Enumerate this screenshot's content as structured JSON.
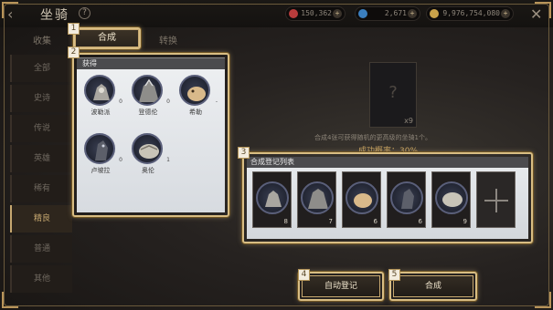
{
  "header": {
    "title": "坐骑",
    "help_symbol": "?",
    "back_symbol": "‹",
    "close_symbol": "✕"
  },
  "currencies": [
    {
      "value": "150,362",
      "color": "#b83c3c",
      "icon": "red-gem-icon"
    },
    {
      "value": "2,671",
      "color": "#3b7fbf",
      "icon": "blue-gem-icon"
    },
    {
      "value": "9,976,754,080",
      "color": "#c9a24a",
      "icon": "gold-coin-icon"
    }
  ],
  "subtabs": [
    "收集",
    "合成",
    "转换"
  ],
  "categories": [
    "全部",
    "史诗",
    "传说",
    "英雄",
    "稀有",
    "精良",
    "普通",
    "其他"
  ],
  "active_category_index": 5,
  "synth_tab": {
    "label": "合成"
  },
  "acquired": {
    "title": "获得",
    "mounts": [
      {
        "name": "波勒派",
        "level": "0",
        "icon": "mount-polepai-icon"
      },
      {
        "name": "登德伦",
        "level": "0",
        "icon": "mount-dendelun-icon"
      },
      {
        "name": "希勒",
        "level": "-",
        "icon": "mount-xile-icon"
      },
      {
        "name": "卢坡拉",
        "level": "0",
        "icon": "mount-lupola-icon"
      },
      {
        "name": "奥伦",
        "level": "1",
        "icon": "mount-aolun-icon"
      }
    ]
  },
  "result_slot": {
    "symbol": "?",
    "count": "x9"
  },
  "description": "合成4张可获得随机的更高级的坐骑1个。",
  "success_rate": "成功概率：30%",
  "register_list": {
    "title": "合成登记列表",
    "cards": [
      {
        "count": "8",
        "icon": "mount-card-1-icon"
      },
      {
        "count": "7",
        "icon": "mount-card-2-icon"
      },
      {
        "count": "6",
        "icon": "mount-card-3-icon"
      },
      {
        "count": "6",
        "icon": "mount-card-4-icon"
      },
      {
        "count": "9",
        "icon": "mount-card-5-icon"
      }
    ],
    "empty_slot_icon": "add-slot-icon"
  },
  "buttons": {
    "auto_register": "自动登记",
    "synthesize": "合成"
  },
  "badges": [
    "1",
    "2",
    "3",
    "4",
    "5"
  ],
  "colors": {
    "accent_gold": "#c7a870",
    "highlight": "#d8bd83",
    "panel": "#e9ecef"
  }
}
